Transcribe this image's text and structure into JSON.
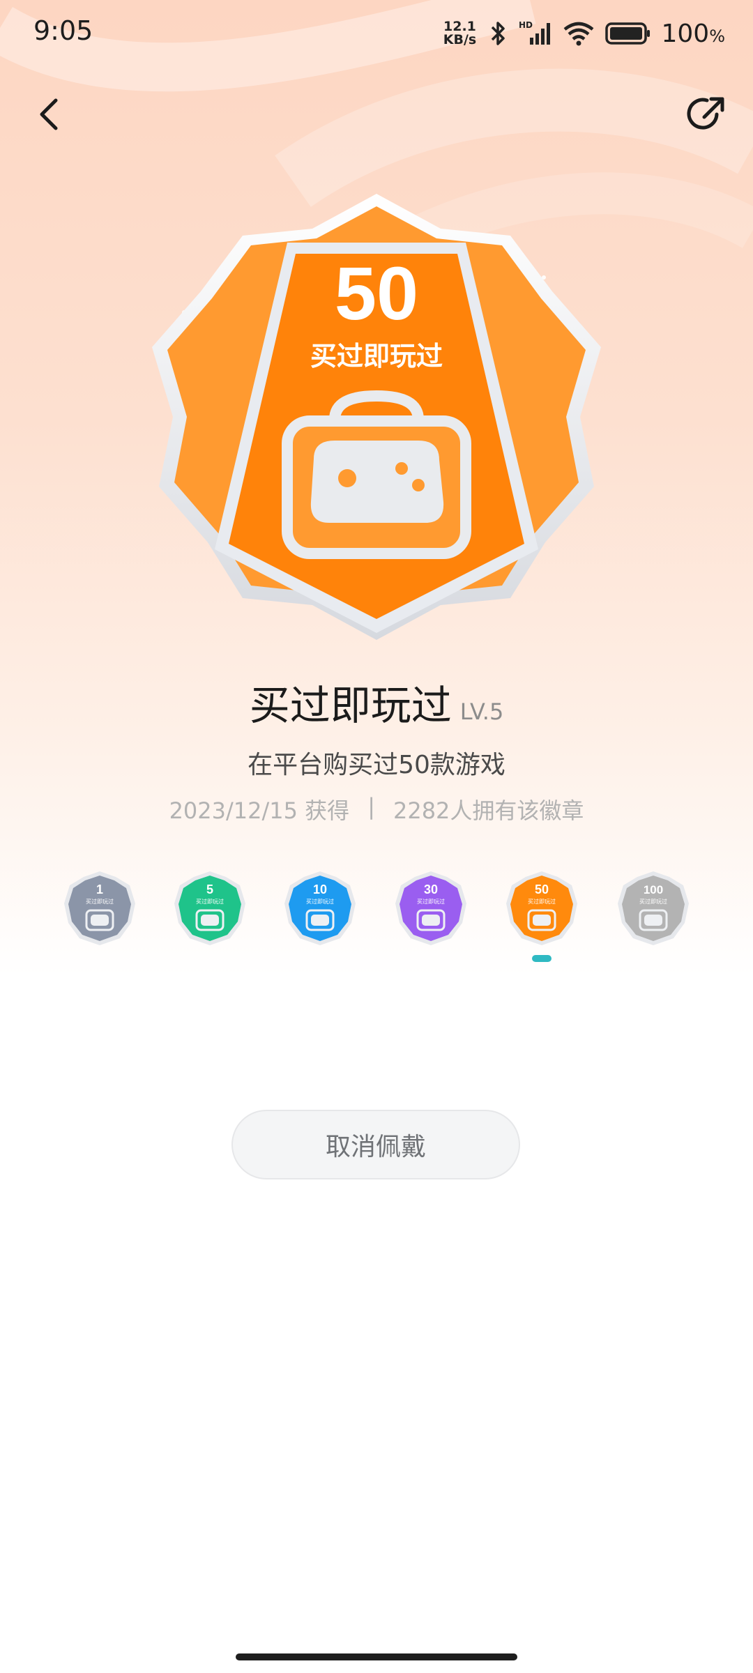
{
  "status_bar": {
    "time": "9:05",
    "net_speed_value": "12.1",
    "net_speed_unit": "KB/s",
    "battery_percent": "100",
    "battery_unit": "%",
    "hd_label": "HD"
  },
  "nav": {
    "back_icon": "chevron-left-icon",
    "share_icon": "share-icon"
  },
  "hero_badge": {
    "number": "50",
    "name": "买过即玩过",
    "color": "#ff8a0d"
  },
  "badge_info": {
    "title": "买过即玩过",
    "level": "LV.5",
    "description": "在平台购买过50款游戏",
    "obtained_date": "2023/12/15 获得",
    "divider": "|",
    "owners": "2282人拥有该徽章"
  },
  "levels": [
    {
      "number": "1",
      "label": "买过即玩过",
      "color": "#8b95a8",
      "selected": false
    },
    {
      "number": "5",
      "label": "买过即玩过",
      "color": "#1fc38a",
      "selected": false
    },
    {
      "number": "10",
      "label": "买过即玩过",
      "color": "#1e9bf0",
      "selected": false
    },
    {
      "number": "30",
      "label": "买过即玩过",
      "color": "#9a5ef0",
      "selected": false
    },
    {
      "number": "50",
      "label": "买过即玩过",
      "color": "#ff8a0d",
      "selected": true
    },
    {
      "number": "100",
      "label": "买过即玩过",
      "color": "#b3b3b3",
      "selected": false
    }
  ],
  "actions": {
    "cancel_label": "取消佩戴"
  }
}
